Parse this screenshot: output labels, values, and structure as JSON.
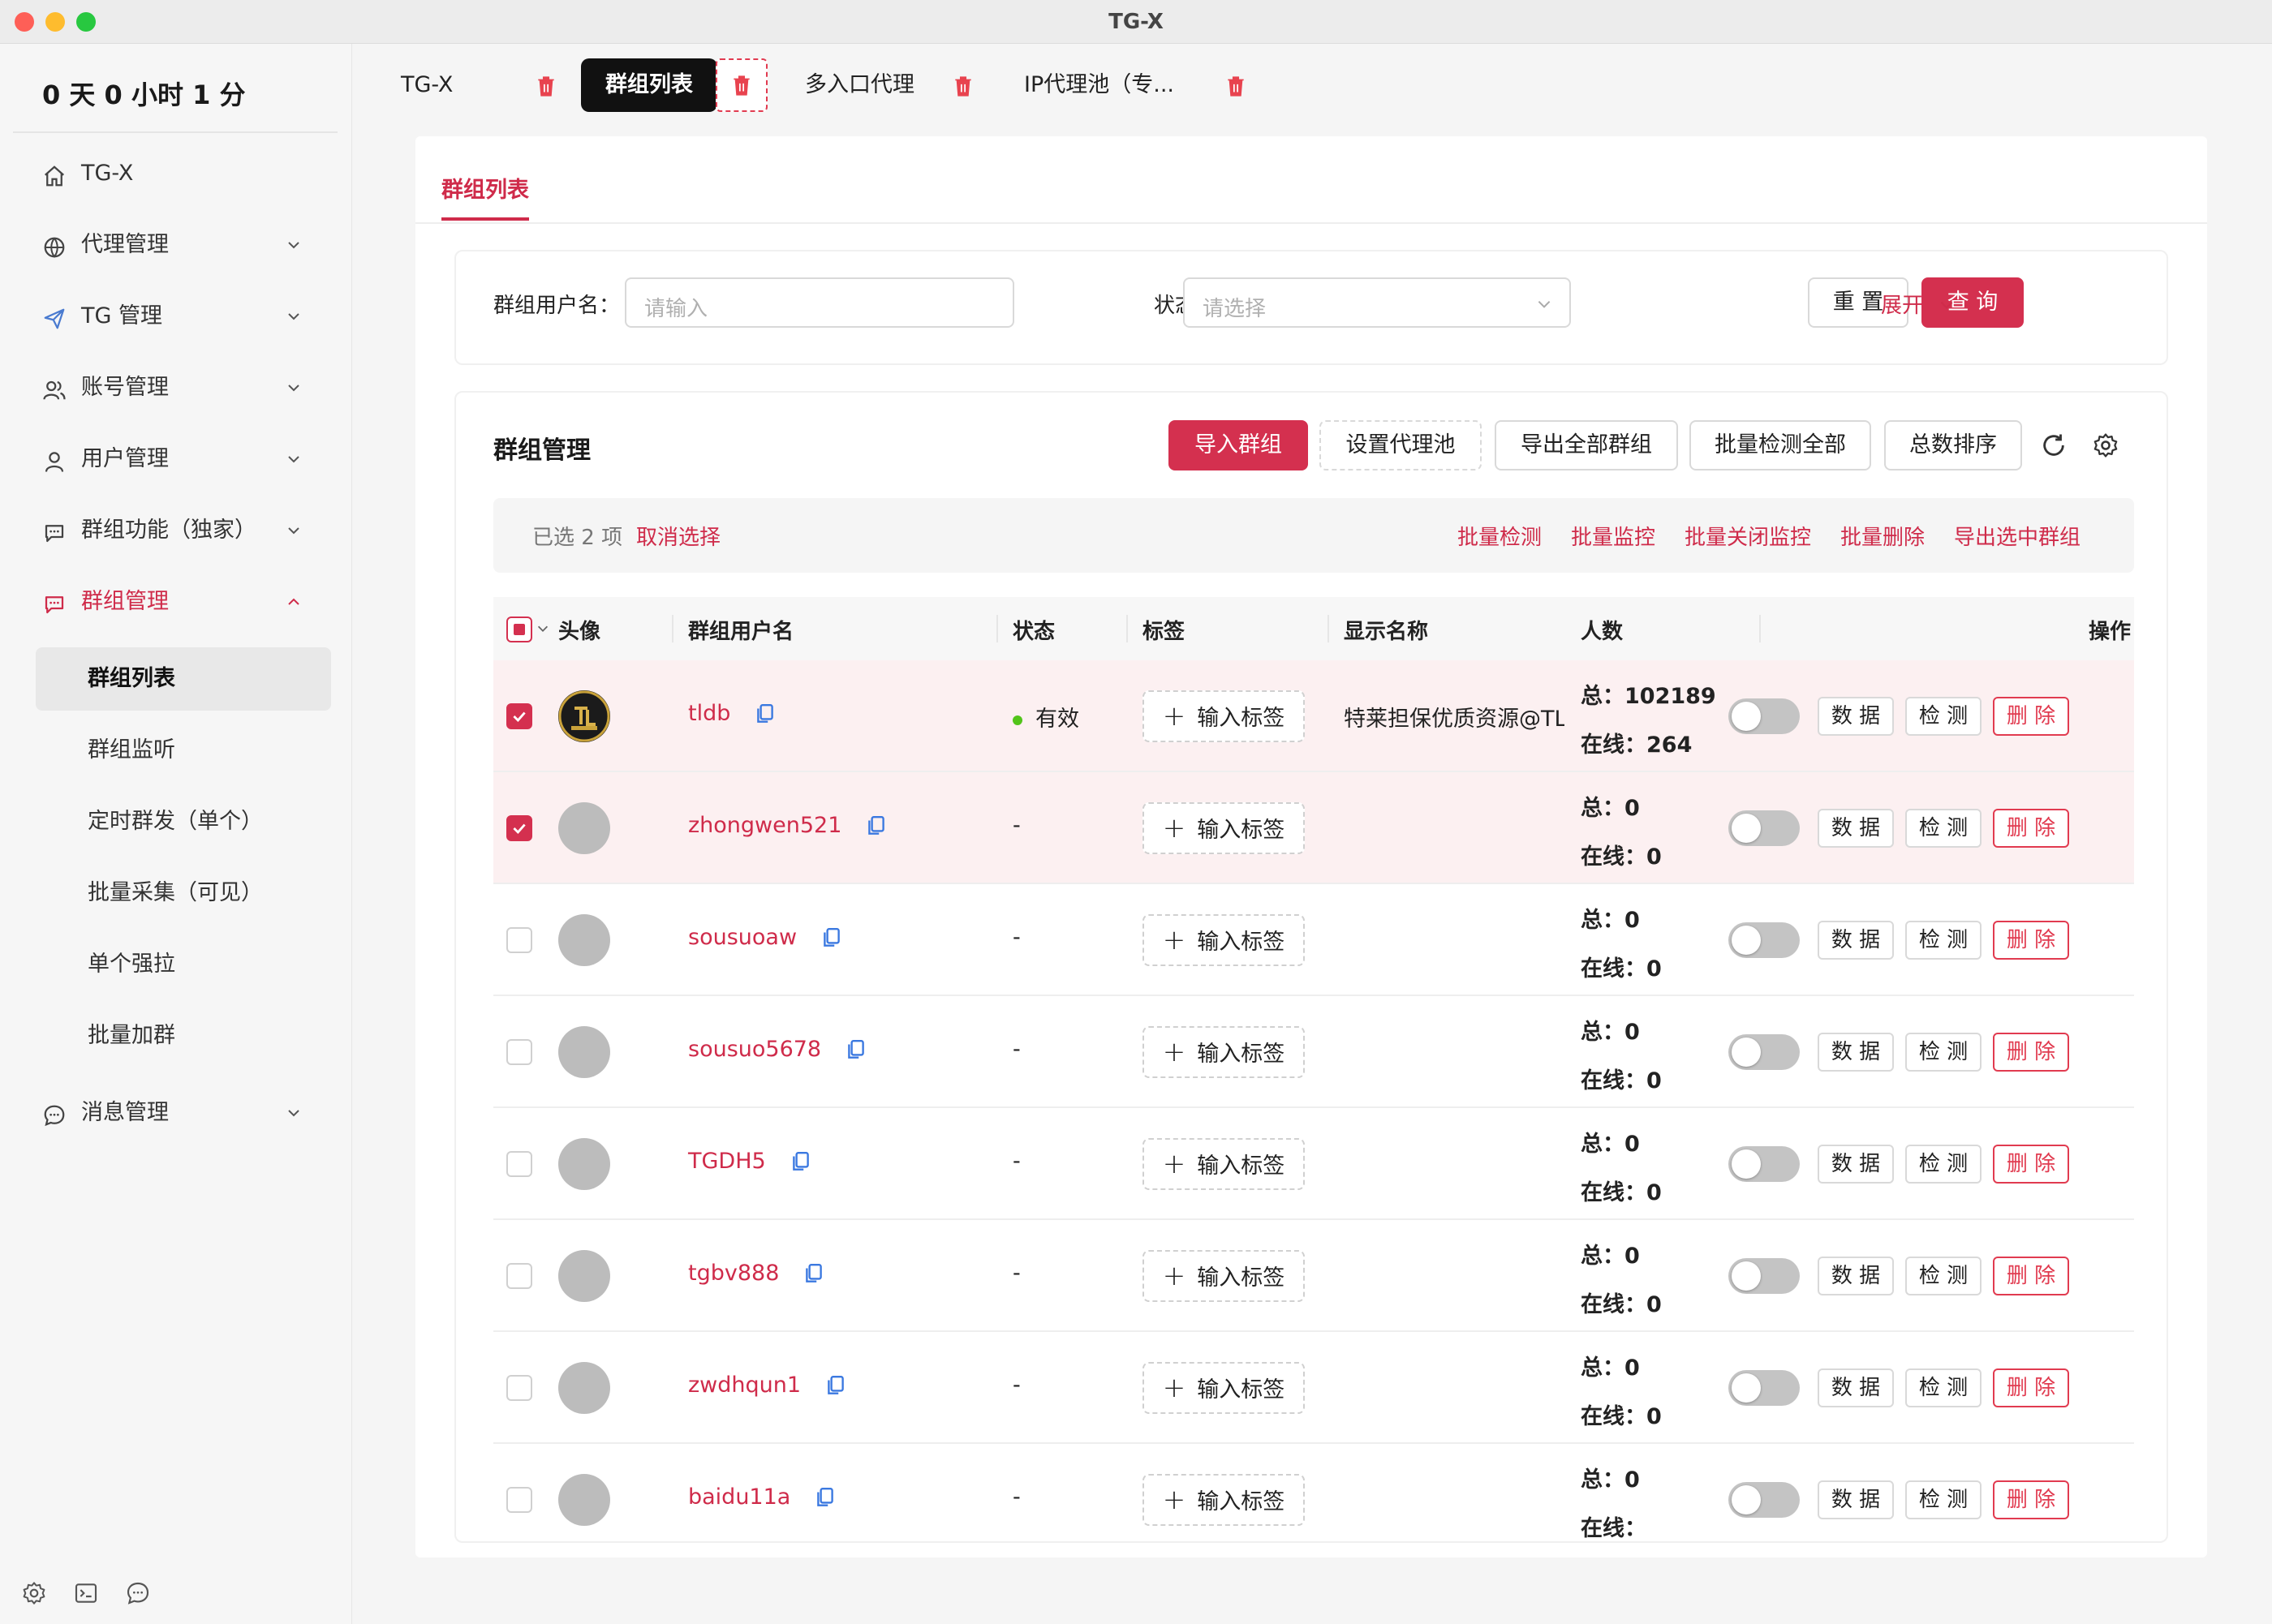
{
  "window": {
    "title": "TG-X"
  },
  "sidebar": {
    "uptime": "0 天 0 小时 1 分",
    "items": [
      {
        "label": "TG-X",
        "icon": "home-icon"
      },
      {
        "label": "代理管理",
        "icon": "globe-icon"
      },
      {
        "label": "TG 管理",
        "icon": "send-icon"
      },
      {
        "label": "账号管理",
        "icon": "users-icon"
      },
      {
        "label": "用户管理",
        "icon": "user-icon"
      },
      {
        "label": "群组功能（独家）",
        "icon": "chat-icon"
      },
      {
        "label": "群组管理",
        "icon": "chat-icon"
      },
      {
        "label": "消息管理",
        "icon": "message-icon"
      }
    ],
    "sub_items": [
      {
        "label": "群组列表"
      },
      {
        "label": "群组监听"
      },
      {
        "label": "定时群发（单个）"
      },
      {
        "label": "批量采集（可见）"
      },
      {
        "label": "单个强拉"
      },
      {
        "label": "批量加群"
      }
    ],
    "footer_icons": [
      "gear-icon",
      "terminal-icon",
      "chat-icon"
    ]
  },
  "tabs": [
    {
      "label": "TG-X"
    },
    {
      "label": "群组列表"
    },
    {
      "label": "多入口代理"
    },
    {
      "label": "IP代理池（专..."
    }
  ],
  "page": {
    "subtab": "群组列表"
  },
  "filter": {
    "username_label": "群组用户名：",
    "username_placeholder": "请输入",
    "status_label": "状态：",
    "status_placeholder": "请选择",
    "reset": "重 置",
    "search": "查 询",
    "expand": "展开"
  },
  "card": {
    "title": "群组管理",
    "buttons": {
      "import": "导入群组",
      "set_proxy": "设置代理池",
      "export_all": "导出全部群组",
      "batch_check_all": "批量检测全部",
      "sort_total": "总数排序"
    },
    "icons": [
      "refresh-icon",
      "gear-icon"
    ]
  },
  "selection": {
    "info": "已选 2 项",
    "cancel": "取消选择",
    "actions": [
      "批量检测",
      "批量监控",
      "批量关闭监控",
      "批量删除",
      "导出选中群组"
    ]
  },
  "table": {
    "columns": {
      "avatar": "头像",
      "username": "群组用户名",
      "status": "状态",
      "tags": "标签",
      "display_name": "显示名称",
      "count": "人数",
      "actions": "操作"
    },
    "total_prefix": "总：",
    "online_prefix": "在线：",
    "tag_button": "输入标签",
    "action_labels": {
      "data": "数 据",
      "check": "检 测",
      "delete": "删 除"
    },
    "rows": [
      {
        "username": "tldb",
        "status": "有效",
        "display_name": "特莱担保优质资源@TL",
        "total": "102189",
        "online": "264",
        "selected": true
      },
      {
        "username": "zhongwen521",
        "status": "-",
        "display_name": "",
        "total": "0",
        "online": "0",
        "selected": true
      },
      {
        "username": "sousuoaw",
        "status": "-",
        "display_name": "",
        "total": "0",
        "online": "0",
        "selected": false
      },
      {
        "username": "sousuo5678",
        "status": "-",
        "display_name": "",
        "total": "0",
        "online": "0",
        "selected": false
      },
      {
        "username": "TGDH5",
        "status": "-",
        "display_name": "",
        "total": "0",
        "online": "0",
        "selected": false
      },
      {
        "username": "tgbv888",
        "status": "-",
        "display_name": "",
        "total": "0",
        "online": "0",
        "selected": false
      },
      {
        "username": "zwdhqun1",
        "status": "-",
        "display_name": "",
        "total": "0",
        "online": "0",
        "selected": false
      },
      {
        "username": "baidu11a",
        "status": "-",
        "display_name": "",
        "total": "0",
        "online": "",
        "selected": false
      }
    ]
  },
  "colors": {
    "accent": "#d4304f",
    "valid_dot": "#52c41a"
  }
}
